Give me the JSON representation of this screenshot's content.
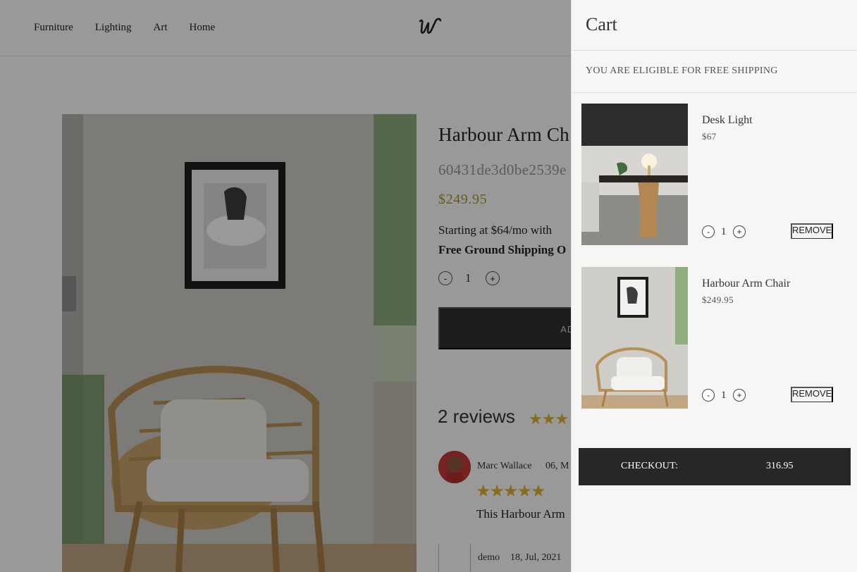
{
  "header": {
    "nav": [
      "Furniture",
      "Lighting",
      "Art",
      "Home"
    ]
  },
  "product": {
    "title": "Harbour Arm Ch",
    "sku": "60431de3d0be2539e",
    "price": "$249.95",
    "financing": "Starting at $64/mo with",
    "shipping": "Free Ground Shipping O",
    "quantity": "1",
    "qty_minus": "-",
    "qty_plus": "+",
    "add_label": "ADD"
  },
  "reviews": {
    "heading": "2 reviews",
    "summary_rating": 4,
    "items": [
      {
        "author": "Marc Wallace",
        "date": "06, M",
        "rating": 5,
        "text": "This Harbour Arm"
      },
      {
        "author": "demo",
        "date": "18, Jul, 2021"
      }
    ]
  },
  "cart": {
    "title": "Cart",
    "notice": "YOU ARE ELIGIBLE FOR FREE SHIPPING",
    "items": [
      {
        "name": "Desk Light",
        "price": "$67",
        "quantity": "1",
        "remove_label": "REMOVE",
        "qty_minus": "-",
        "qty_plus": "+"
      },
      {
        "name": "Harbour Arm Chair",
        "price": "$249.95",
        "quantity": "1",
        "remove_label": "REMOVE",
        "qty_minus": "-",
        "qty_plus": "+"
      }
    ],
    "checkout_label": "CHECKOUT:",
    "checkout_total": "316.95"
  },
  "colors": {
    "price_accent": "#b3962a",
    "star": "#e2b233",
    "checkout_bg": "#272727",
    "add_bg": "#2f2f2f",
    "drawer_bg": "#f7f6f4"
  }
}
